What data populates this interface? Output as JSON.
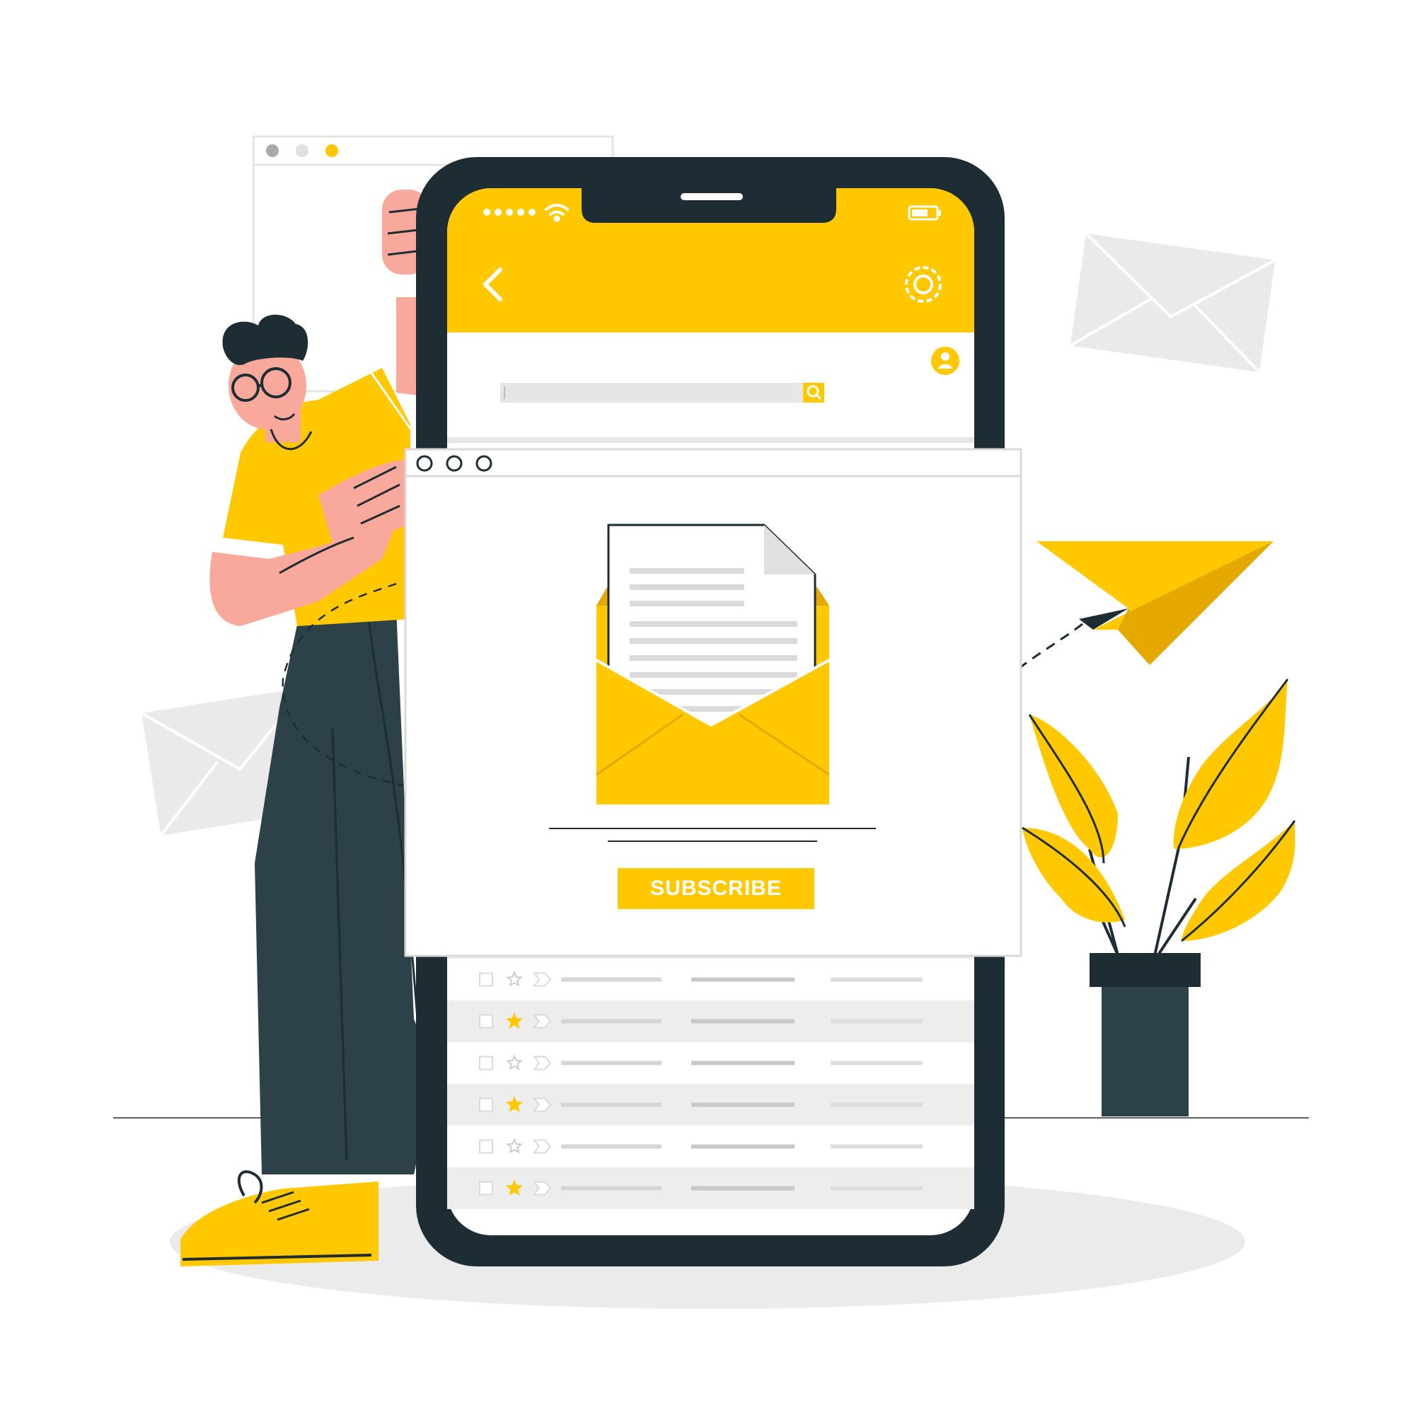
{
  "colors": {
    "accent": "#FFC800",
    "accent_dark": "#E5A800",
    "phone_frame": "#1E2C33",
    "pants": "#2D4149",
    "skin": "#F9A99B",
    "muted_gray": "#E8E8E8"
  },
  "phone": {
    "header": {
      "back_icon": "chevron-left-icon",
      "settings_icon": "gear-icon"
    },
    "search": {
      "icon": "search-icon"
    },
    "profile_icon": "user-icon",
    "status_bar": {
      "signal_icon": "signal-dots-icon",
      "wifi_icon": "wifi-icon",
      "battery_icon": "battery-icon"
    },
    "inbox": {
      "rows": [
        {
          "starred": false
        },
        {
          "starred": false
        },
        {
          "starred": true
        },
        {
          "starred": false
        },
        {
          "starred": true
        },
        {
          "starred": false
        },
        {
          "starred": true
        }
      ]
    }
  },
  "popup": {
    "window_controls": [
      "circle",
      "circle",
      "circle"
    ],
    "illustration": "open-envelope-with-letter",
    "subscribe_label": "SUBSCRIBE"
  },
  "decor": {
    "paper_plane_icon": "paper-plane-icon",
    "background_envelope_icon": "envelope-icon",
    "plant_icon": "potted-plant-icon"
  }
}
